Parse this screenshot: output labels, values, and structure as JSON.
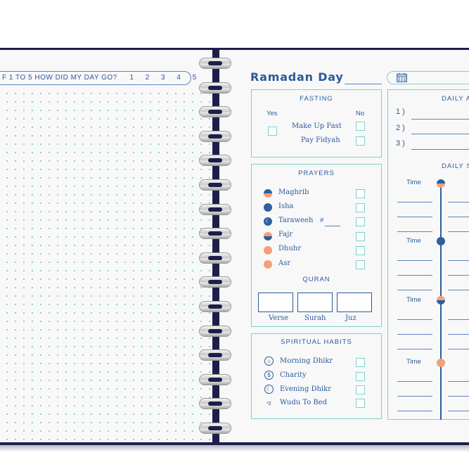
{
  "left_page": {
    "rating_prompt": "F 1 TO 5 HOW DID MY DAY GO?",
    "rating_options": [
      "1",
      "2",
      "3",
      "4",
      "5"
    ]
  },
  "right_page": {
    "title": "Ramadan  Day",
    "date_icon": "calendar-icon",
    "fasting": {
      "title": "FASTING",
      "yes_label": "Yes",
      "no_label": "No",
      "items": [
        "Make Up Fast",
        "Pay Fidyah"
      ]
    },
    "prayers": {
      "title": "PRAYERS",
      "items": [
        "Maghrib",
        "Isha",
        "Taraweeh",
        "Fajr",
        "Dhuhr",
        "Asr"
      ],
      "taraweeh_count_label": "#"
    },
    "quran": {
      "title": "QURAN",
      "fields": [
        "Verse",
        "Surah",
        "Juz"
      ]
    },
    "spiritual_habits": {
      "title": "SPIRITUAL HABITS",
      "items": [
        "Morning Dhikr",
        "Charity",
        "Evening Dhikr",
        "Wudu To Bed"
      ],
      "icons": [
        "sunrise-icon",
        "dollar-coin-icon",
        "moon-icon",
        "sleep-icon"
      ]
    },
    "daily_aims": {
      "title": "DAILY A",
      "numbers": [
        "1 )",
        "2 )",
        "3 )"
      ]
    },
    "daily_schedule": {
      "title": "DAILY S",
      "time_label": "Time"
    }
  },
  "colors": {
    "navy_cover": "#1e1e4a",
    "text_blue": "#2a5a9a",
    "teal_border": "#7fd0cc",
    "accent_orange": "#f0a07a"
  }
}
